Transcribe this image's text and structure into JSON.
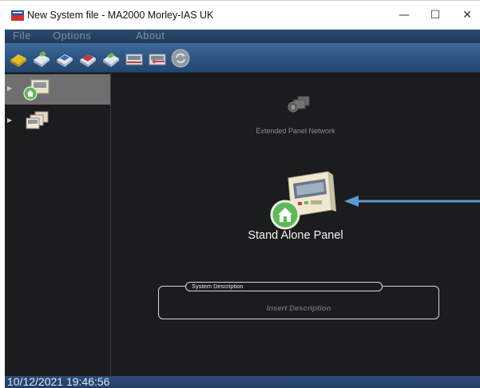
{
  "window": {
    "title": "New System file - MA2000 Morley-IAS UK",
    "minimize_glyph": "—",
    "maximize_glyph": "☐",
    "close_glyph": "✕"
  },
  "menu": {
    "items": [
      {
        "label": "File"
      },
      {
        "label": "Options"
      },
      {
        "label": "About"
      }
    ]
  },
  "toolbar": {
    "buttons": [
      {
        "icon": "new-file-icon",
        "color": "#d8b21e"
      },
      {
        "icon": "open-file-icon",
        "color": "#c9d2dc"
      },
      {
        "icon": "save-file-icon",
        "color": "#3c6fb8"
      },
      {
        "icon": "save-as-file-icon",
        "color": "#c43a3a"
      },
      {
        "icon": "print-file-icon",
        "color": "#6fb64a"
      },
      {
        "icon": "send-to-panel-icon",
        "color": "#c64040"
      },
      {
        "icon": "receive-from-panel-icon",
        "color": "#c64040"
      },
      {
        "icon": "refresh-disabled-icon",
        "color": "#9aa3ad"
      }
    ]
  },
  "sidebar": {
    "items": [
      {
        "name": "stand-alone-panel-node",
        "selected": true
      },
      {
        "name": "extended-panel-network-node",
        "selected": false
      }
    ]
  },
  "main": {
    "network_label": "Extended Panel Network",
    "panel_label": "Stand Alone Panel",
    "description": {
      "header": "System Description",
      "placeholder": "Insert Description"
    }
  },
  "status": {
    "datetime": "10/12/2021  19:46:56"
  },
  "colors": {
    "background": "#1b1c1e",
    "selection": "#6f6f6f",
    "accent_arrow": "#5b9bd5",
    "house_green": "#5fb85a"
  }
}
